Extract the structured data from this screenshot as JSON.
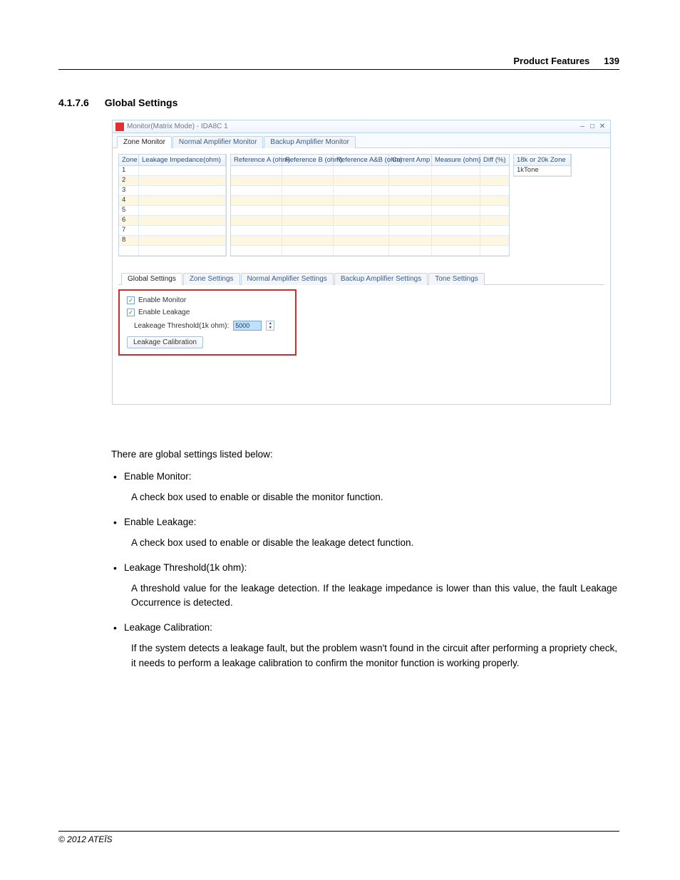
{
  "header": {
    "title": "Product Features",
    "page": "139"
  },
  "section": {
    "number": "4.1.7.6",
    "title": "Global Settings"
  },
  "window": {
    "title": "Monitor(Matrix Mode) - IDA8C 1",
    "upper_tabs": [
      "Zone Monitor",
      "Normal Amplifier Monitor",
      "Backup Amplifier Monitor"
    ],
    "left_grid_headers": [
      "Zone",
      "Leakage Impedance(ohm)"
    ],
    "main_grid_headers": [
      "Reference A (ohm)",
      "Reference B (ohm)",
      "Reference A&B (ohm)",
      "Current Amp",
      "Measure (ohm)",
      "Diff (%)"
    ],
    "right_grid_headers": [
      "18k or 20k Zone"
    ],
    "right_grid_rows": [
      "1kTone"
    ],
    "zone_rows": [
      "1",
      "2",
      "3",
      "4",
      "5",
      "6",
      "7",
      "8"
    ],
    "lower_tabs": [
      "Global Settings",
      "Zone Settings",
      "Normal Amplifier Settings",
      "Backup Amplifier Settings",
      "Tone Settings"
    ],
    "global": {
      "enable_monitor": "Enable Monitor",
      "enable_leakage": "Enable Leakage",
      "threshold_label": "Leakeage Threshold(1k ohm):",
      "threshold_value": "5000",
      "calibration_btn": "Leakage Calibration"
    }
  },
  "body": {
    "intro": "There are global settings listed below:",
    "items": [
      {
        "title": "Enable Monitor:",
        "desc": "A check box used to enable or disable the monitor function."
      },
      {
        "title": "Enable Leakage:",
        "desc": "A check box used to enable or disable the leakage detect function."
      },
      {
        "title": "Leakage Threshold(1k ohm):",
        "desc": "A threshold value for the leakage detection. If the leakage impedance is lower than this value, the fault Leakage Occurrence is detected."
      },
      {
        "title": "Leakage Calibration:",
        "desc": "If the system detects a leakage fault, but the problem wasn't found in the circuit after performing a propriety check, it needs to perform a leakage calibration to confirm the monitor function is working properly."
      }
    ]
  },
  "footer": "© 2012 ATEÏS"
}
